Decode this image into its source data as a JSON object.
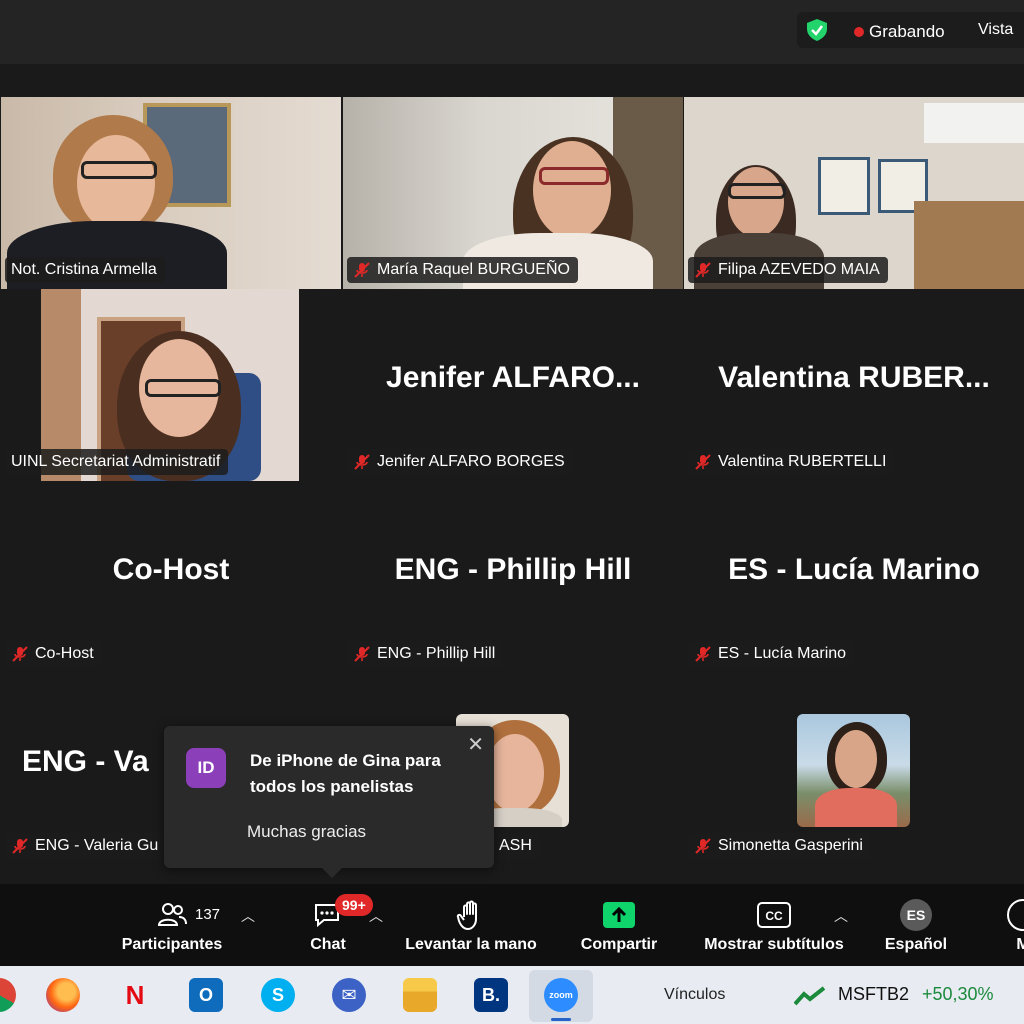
{
  "topbar": {
    "recording_label": "Grabando",
    "view_label": "Vista"
  },
  "tiles": [
    {
      "name": "Not. Cristina Armella"
    },
    {
      "name": "María Raquel BURGUEÑO"
    },
    {
      "name": "Filipa AZEVEDO MAIA"
    },
    {
      "name": "UINL Secretariat Administratif"
    },
    {
      "big": "Jenifer  ALFARO...",
      "name": "Jenifer ALFARO BORGES"
    },
    {
      "big": "Valentina  RUBER...",
      "name": "Valentina RUBERTELLI"
    },
    {
      "big": "Co-Host",
      "name": "Co-Host"
    },
    {
      "big": "ENG - Phillip Hill",
      "name": "ENG - Phillip Hill"
    },
    {
      "big": "ES - Lucía Marino",
      "name": "ES - Lucía Marino"
    },
    {
      "big": "ENG  -  Va",
      "name": "ENG - Valeria Gu"
    },
    {
      "name": "ASH"
    },
    {
      "name": "Simonetta Gasperini"
    }
  ],
  "chat_popup": {
    "avatar_initials": "ID",
    "title": "De iPhone de Gina para todos los panelistas",
    "message": "Muchas gracias"
  },
  "toolbar": {
    "participants_label": "Participantes",
    "participants_count": "137",
    "chat_label": "Chat",
    "chat_badge": "99+",
    "raise_hand_label": "Levantar la mano",
    "share_label": "Compartir",
    "captions_label": "Mostrar subtítulos",
    "language_label": "Español",
    "language_code": "ES",
    "more_label": "M"
  },
  "taskbar": {
    "links_label": "Vínculos",
    "stock_symbol": "MSFTB2",
    "stock_change": "+50,30%",
    "zoom_label": "zoom"
  },
  "colors": {
    "active_speaker": "#23d36b",
    "recording": "#e02828",
    "share": "#0fd46b",
    "chat_badge": "#e02828",
    "avatar": "#8b3fb8"
  }
}
